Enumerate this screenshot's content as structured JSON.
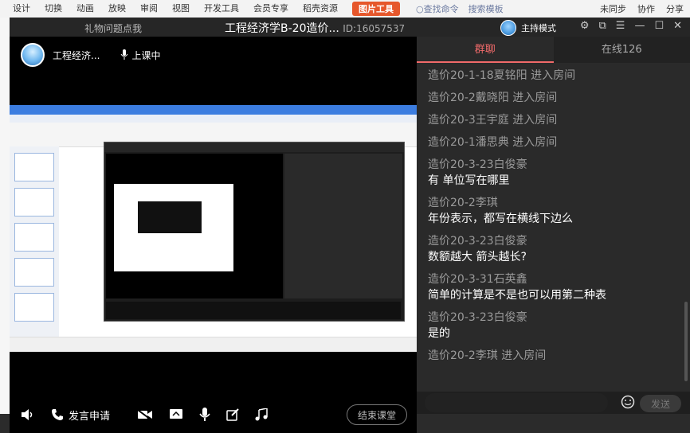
{
  "desktop": {
    "menu": [
      "设计",
      "切换",
      "动画",
      "放映",
      "审阅",
      "视图",
      "开发工具",
      "会员专享",
      "稻壳资源"
    ],
    "picture_tool": "图片工具",
    "search": [
      "查找命令",
      "搜索模板"
    ],
    "right": [
      "未同步",
      "协作",
      "分享"
    ]
  },
  "window": {
    "gift_label": "礼物问题点我",
    "title": "工程经济学B-20造价...",
    "room_id": "ID:16057537",
    "host_mode": "主持模式"
  },
  "teacher": {
    "name": "工程经济...",
    "status": "上课中"
  },
  "controls": {
    "apply_speak": "发言申请",
    "end_class": "结束课堂"
  },
  "chat": {
    "tabs": [
      "群聊",
      "在线126"
    ],
    "messages": [
      {
        "sender": "造价20-1-18夏铭阳 进入房间",
        "text": ""
      },
      {
        "sender": "造价20-2戴晓阳 进入房间",
        "text": ""
      },
      {
        "sender": "造价20-3王宇庭 进入房间",
        "text": ""
      },
      {
        "sender": "造价20-1潘思典 进入房间",
        "text": ""
      },
      {
        "sender": "造价20-3-23白俊豪",
        "text": "有 单位写在哪里"
      },
      {
        "sender": "造价20-2李琪",
        "text": "年份表示，都写在横线下边么"
      },
      {
        "sender": "造价20-3-23白俊豪",
        "text": "数额越大 箭头越长?"
      },
      {
        "sender": "造价20-3-31石英鑫",
        "text": "简单的计算是不是也可以用第二种表"
      },
      {
        "sender": "造价20-3-23白俊豪",
        "text": "是的"
      },
      {
        "sender": "造价20-2李琪 进入房间",
        "text": ""
      }
    ],
    "send_label": "发送"
  }
}
